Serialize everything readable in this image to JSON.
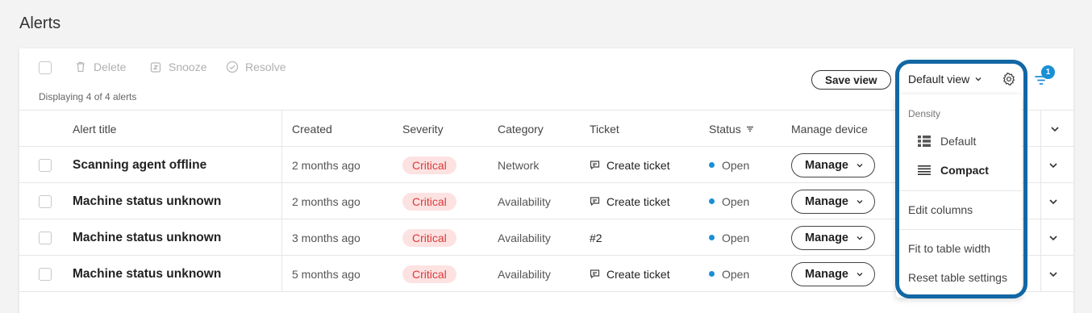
{
  "page_title": "Alerts",
  "toolbar": {
    "delete_label": "Delete",
    "snooze_label": "Snooze",
    "resolve_label": "Resolve",
    "count_text": "Displaying 4 of 4 alerts",
    "save_view_label": "Save view",
    "view_select": "Default view",
    "filter_badge": "1"
  },
  "columns": [
    "Alert title",
    "Created",
    "Severity",
    "Category",
    "Ticket",
    "Status",
    "Manage device"
  ],
  "rows": [
    {
      "title": "Scanning agent offline",
      "created": "2 months ago",
      "severity": "Critical",
      "category": "Network",
      "ticket": "Create ticket",
      "status": "Open",
      "manage": "Manage"
    },
    {
      "title": "Machine status unknown",
      "created": "2 months ago",
      "severity": "Critical",
      "category": "Availability",
      "ticket": "Create ticket",
      "status": "Open",
      "manage": "Manage"
    },
    {
      "title": "Machine status unknown",
      "created": "3 months ago",
      "severity": "Critical",
      "category": "Availability",
      "ticket": "#2",
      "status": "Open",
      "manage": "Manage"
    },
    {
      "title": "Machine status unknown",
      "created": "5 months ago",
      "severity": "Critical",
      "category": "Availability",
      "ticket": "Create ticket",
      "status": "Open",
      "manage": "Manage"
    }
  ],
  "settings_menu": {
    "density_heading": "Density",
    "density_default": "Default",
    "density_compact": "Compact",
    "edit_columns": "Edit columns",
    "fit_to_width": "Fit to table width",
    "reset_settings": "Reset table settings"
  },
  "colors": {
    "accent": "#1a8fd6",
    "critical_bg": "#fde2e2",
    "critical_text": "#d93a3a",
    "highlight": "#1267a4"
  }
}
